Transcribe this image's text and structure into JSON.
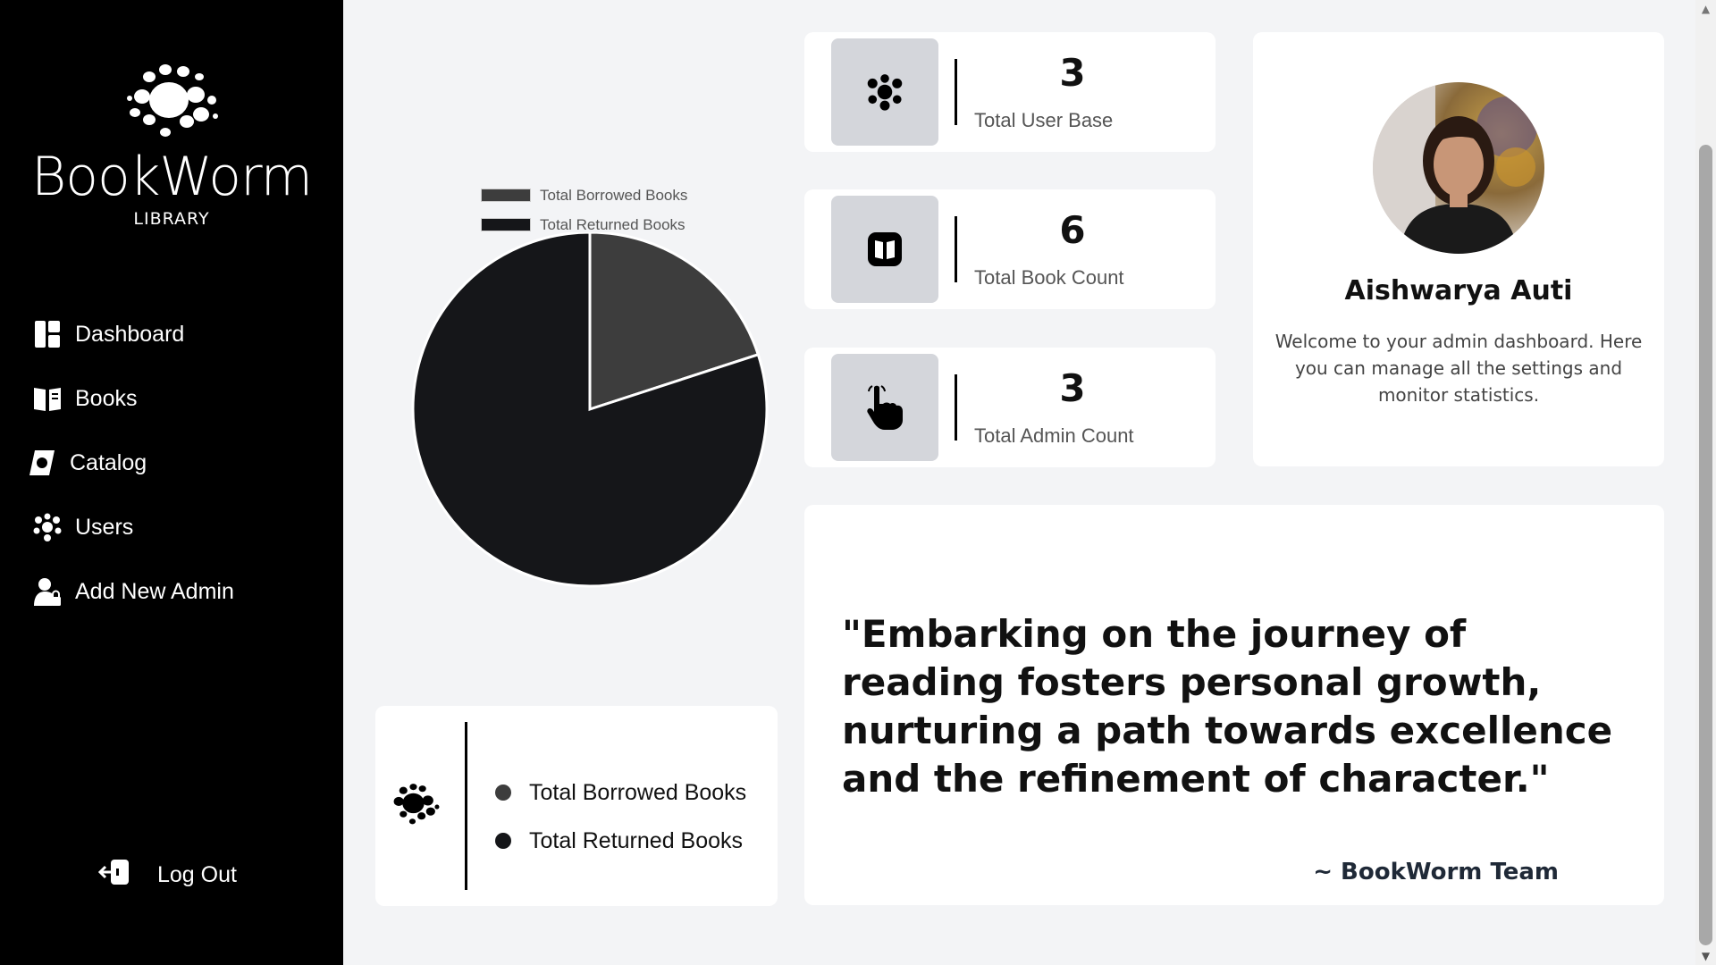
{
  "brand": {
    "name": "BookWorm",
    "sub": "LIBRARY"
  },
  "sidebar": {
    "items": [
      {
        "label": "Dashboard",
        "icon": "dashboard-icon"
      },
      {
        "label": "Books",
        "icon": "book-open-icon"
      },
      {
        "label": "Catalog",
        "icon": "catalog-icon"
      },
      {
        "label": "Users",
        "icon": "users-icon"
      },
      {
        "label": "Add New Admin",
        "icon": "add-admin-icon"
      }
    ],
    "logout": "Log Out"
  },
  "stats": [
    {
      "value": "3",
      "label": "Total User Base",
      "icon": "users-icon"
    },
    {
      "value": "6",
      "label": "Total Book Count",
      "icon": "book-icon"
    },
    {
      "value": "3",
      "label": "Total Admin Count",
      "icon": "pointer-hand-icon"
    }
  ],
  "profile": {
    "name": "Aishwarya Auti",
    "description": "Welcome to your admin dashboard. Here you can manage all the settings and monitor statistics."
  },
  "quote": {
    "text": "\"Embarking on the journey of reading fosters personal growth, nurturing a path towards excellence and the refinement of character.\"",
    "author": "~ BookWorm Team"
  },
  "legend_card": {
    "items": [
      "Total Borrowed Books",
      "Total Returned Books"
    ]
  },
  "colors": {
    "borrowed": "#3d3d3d",
    "returned": "#151619",
    "sidebar": "#000000"
  },
  "chart_data": {
    "type": "pie",
    "categories": [
      "Total Borrowed Books",
      "Total Returned Books"
    ],
    "values": [
      1,
      4
    ],
    "legend": "top"
  }
}
